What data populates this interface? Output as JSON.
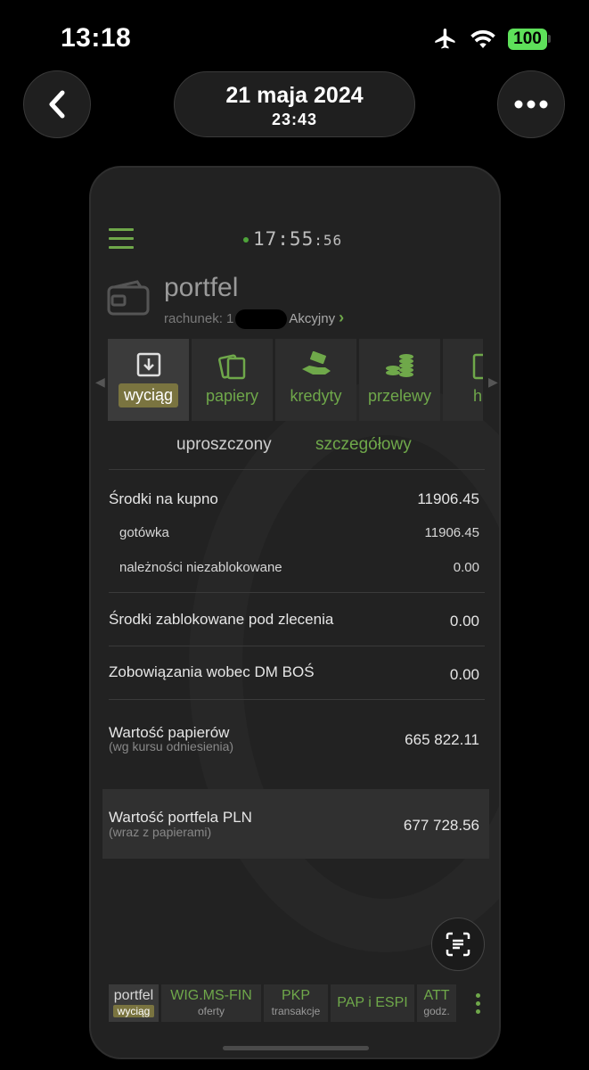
{
  "status_bar": {
    "time": "13:18",
    "battery": "100"
  },
  "viewer": {
    "date": "21 maja 2024",
    "time": "23:43"
  },
  "app": {
    "clock": {
      "main": "17:55",
      "seconds": ":56"
    },
    "account": {
      "title": "portfel",
      "sub_prefix": "rachunek: 1",
      "type": "Akcyjny"
    },
    "tiles": [
      {
        "label": "wyciąg",
        "icon": "download-icon"
      },
      {
        "label": "papiery",
        "icon": "documents-icon"
      },
      {
        "label": "kredyty",
        "icon": "hand-money-icon"
      },
      {
        "label": "przelewy",
        "icon": "coins-icon"
      },
      {
        "label": "his",
        "icon": "history-icon"
      }
    ],
    "view_switch": {
      "simple": "uproszczony",
      "detailed": "szczegółowy"
    },
    "summary": {
      "funds_label": "Środki na kupno",
      "funds_value": "11906.45",
      "cash_label": "gotówka",
      "cash_value": "11906.45",
      "receivables_label": "należności niezablokowane",
      "receivables_value": "0.00",
      "blocked_label": "Środki zablokowane pod zlecenia",
      "blocked_value": "0.00",
      "liabilities_label": "Zobowiązania wobec DM BOŚ",
      "liabilities_value": "0.00",
      "securities_label": "Wartość papierów",
      "securities_note": "(wg kursu odniesienia)",
      "securities_value": "665 822.11",
      "portfolio_label": "Wartość portfela PLN",
      "portfolio_note": "(wraz z papierami)",
      "portfolio_value": "677 728.56"
    },
    "bottom_tabs": [
      {
        "title": "portfel",
        "sub": "wyciąg"
      },
      {
        "title": "WIG.MS-FIN",
        "sub": "oferty"
      },
      {
        "title": "PKP",
        "sub": "transakcje"
      },
      {
        "title": "PAP i ESPI",
        "sub": ""
      },
      {
        "title": "ATT",
        "sub": "godz."
      }
    ]
  },
  "colors": {
    "accent_green": "#6fa84a",
    "active_badge": "#7a7440",
    "battery": "#5ee05a"
  }
}
